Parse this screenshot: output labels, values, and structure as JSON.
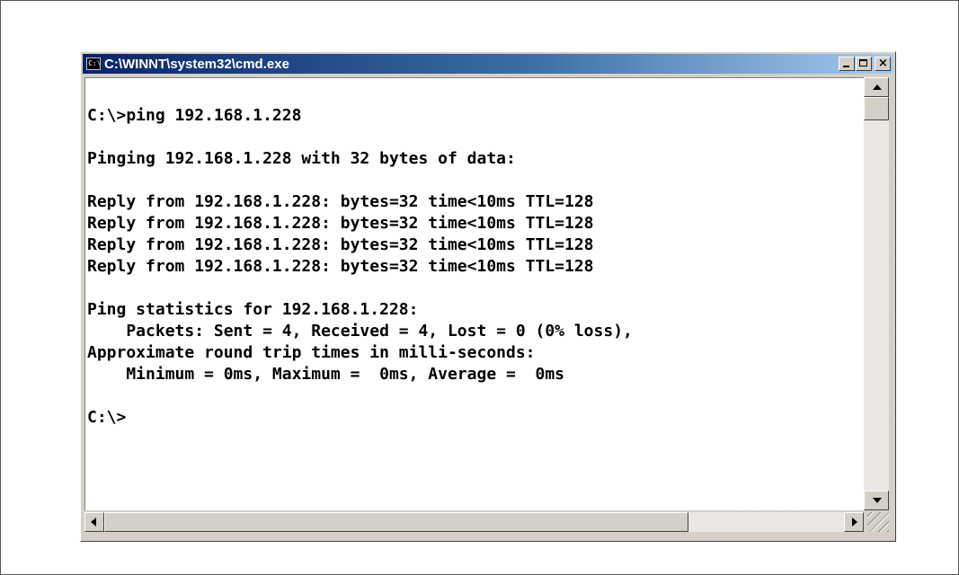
{
  "window": {
    "title": "C:\\WINNT\\system32\\cmd.exe",
    "icon_text": "C:\\",
    "icon": "cmd-icon",
    "title_gradient": [
      "#0a246a",
      "#a6caf0"
    ]
  },
  "titlebar_buttons": {
    "minimize": "minimize-icon",
    "maximize": "maximize-icon",
    "close": "close-icon",
    "close_glyph": "×"
  },
  "console": {
    "lines": [
      "",
      "C:\\>ping 192.168.1.228",
      "",
      "Pinging 192.168.1.228 with 32 bytes of data:",
      "",
      "Reply from 192.168.1.228: bytes=32 time<10ms TTL=128",
      "Reply from 192.168.1.228: bytes=32 time<10ms TTL=128",
      "Reply from 192.168.1.228: bytes=32 time<10ms TTL=128",
      "Reply from 192.168.1.228: bytes=32 time<10ms TTL=128",
      "",
      "Ping statistics for 192.168.1.228:",
      "    Packets: Sent = 4, Received = 4, Lost = 0 (0% loss),",
      "Approximate round trip times in milli-seconds:",
      "    Minimum = 0ms, Maximum =  0ms, Average =  0ms",
      "",
      "C:\\>"
    ]
  },
  "scrollbars": {
    "vertical_position": 0.0,
    "horizontal_position": 0.0
  }
}
